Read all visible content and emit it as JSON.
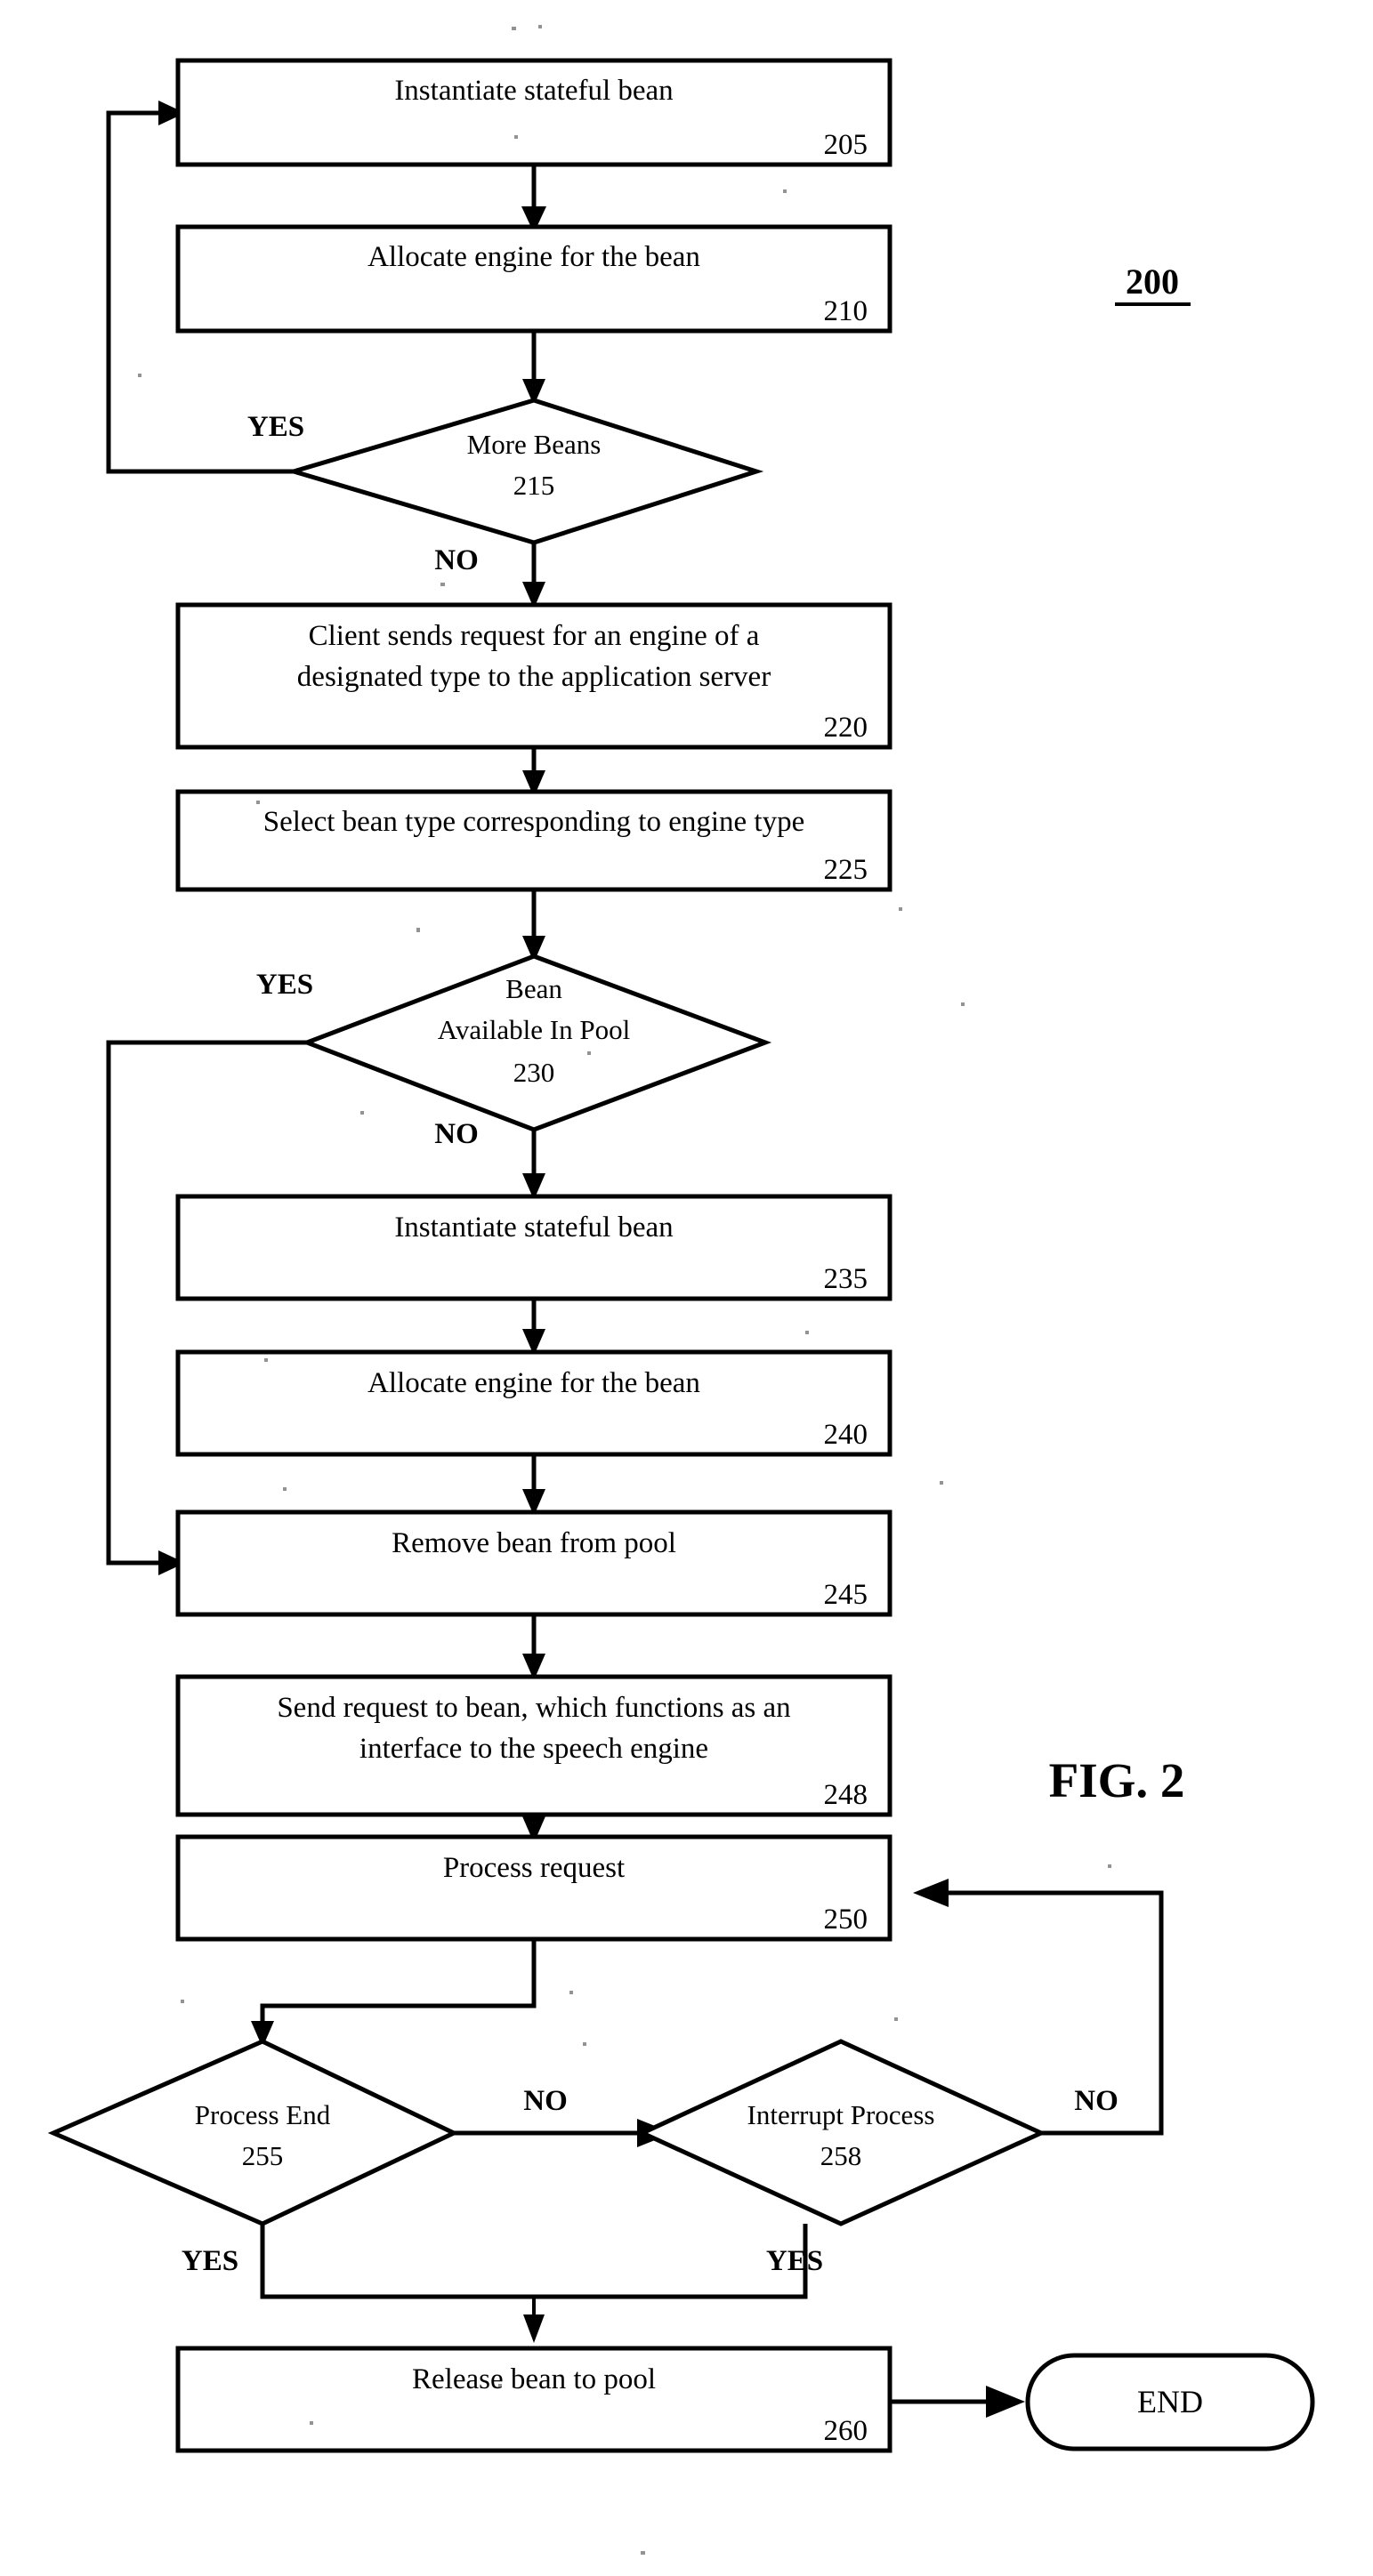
{
  "figure": {
    "caption": "FIG. 2",
    "number": "200"
  },
  "flowchart": {
    "type": "flowchart",
    "title": "FIG. 2",
    "reference_numeral": "200",
    "nodes": [
      {
        "id": "205",
        "shape": "process",
        "ref": "205",
        "lines": [
          "Instantiate stateful bean"
        ]
      },
      {
        "id": "210",
        "shape": "process",
        "ref": "210",
        "lines": [
          "Allocate engine for the bean"
        ]
      },
      {
        "id": "215",
        "shape": "decision",
        "ref": "215",
        "lines": [
          "More Beans",
          "215"
        ]
      },
      {
        "id": "220",
        "shape": "process",
        "ref": "220",
        "lines": [
          "Client sends request for an engine of a",
          "designated type to the application server"
        ]
      },
      {
        "id": "225",
        "shape": "process",
        "ref": "225",
        "lines": [
          "Select bean type corresponding to engine type"
        ]
      },
      {
        "id": "230",
        "shape": "decision",
        "ref": "230",
        "lines": [
          "Bean",
          "Available In Pool",
          "230"
        ]
      },
      {
        "id": "235",
        "shape": "process",
        "ref": "235",
        "lines": [
          "Instantiate stateful bean"
        ]
      },
      {
        "id": "240",
        "shape": "process",
        "ref": "240",
        "lines": [
          "Allocate engine for the bean"
        ]
      },
      {
        "id": "245",
        "shape": "process",
        "ref": "245",
        "lines": [
          "Remove bean from pool"
        ]
      },
      {
        "id": "248",
        "shape": "process",
        "ref": "248",
        "lines": [
          "Send request to bean, which functions as an",
          "interface to the speech engine"
        ]
      },
      {
        "id": "250",
        "shape": "process",
        "ref": "250",
        "lines": [
          "Process request"
        ]
      },
      {
        "id": "255",
        "shape": "decision",
        "ref": "255",
        "lines": [
          "Process End",
          "255"
        ]
      },
      {
        "id": "258",
        "shape": "decision",
        "ref": "258",
        "lines": [
          "Interrupt Process",
          "258"
        ]
      },
      {
        "id": "260",
        "shape": "process",
        "ref": "260",
        "lines": [
          "Release bean to pool"
        ]
      },
      {
        "id": "end",
        "shape": "terminator",
        "ref": "",
        "lines": [
          "END"
        ]
      }
    ],
    "edge_labels": {
      "b215_yes": "YES",
      "b215_no": "NO",
      "b230_yes": "YES",
      "b230_no": "NO",
      "b255_yes": "YES",
      "b255_no": "NO",
      "b258_yes": "YES",
      "b258_no": "NO"
    }
  },
  "text": {
    "n205_l1": "Instantiate stateful bean",
    "n205_ref": "205",
    "n210_l1": "Allocate engine for the bean",
    "n210_ref": "210",
    "n215_l1": "More Beans",
    "n215_l2": "215",
    "n220_l1": "Client sends request for an engine of a",
    "n220_l2": "designated type to the application server",
    "n220_ref": "220",
    "n225_l1": "Select bean type corresponding to engine type",
    "n225_ref": "225",
    "n230_l1": "Bean",
    "n230_l2": "Available In Pool",
    "n230_l3": "230",
    "n235_l1": "Instantiate stateful bean",
    "n235_ref": "235",
    "n240_l1": "Allocate engine for the bean",
    "n240_ref": "240",
    "n245_l1": "Remove bean from pool",
    "n245_ref": "245",
    "n248_l1": "Send request to bean, which functions as an",
    "n248_l2": "interface to the speech engine",
    "n248_ref": "248",
    "n250_l1": "Process request",
    "n250_ref": "250",
    "n255_l1": "Process End",
    "n255_l2": "255",
    "n258_l1": "Interrupt Process",
    "n258_l2": "258",
    "n260_l1": "Release bean to pool",
    "n260_ref": "260",
    "end_label": "END",
    "yes_215": "YES",
    "no_215": "NO",
    "yes_230": "YES",
    "no_230": "NO",
    "yes_255": "YES",
    "no_255": "NO",
    "yes_258": "YES",
    "no_258": "NO",
    "fig_caption": "FIG. 2",
    "fig_number": "200"
  },
  "colors": {
    "stroke": "#000000",
    "fill": "#ffffff",
    "background": "#ffffff"
  }
}
